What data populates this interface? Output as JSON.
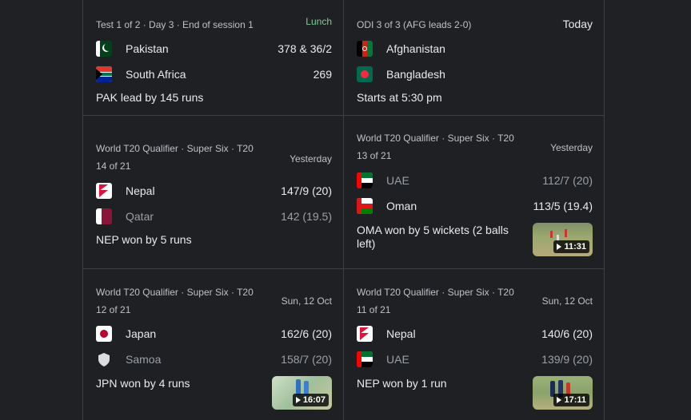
{
  "cards": [
    {
      "meta": "Test 1 of 2 · Day 3 · End of session 1",
      "when": "Lunch",
      "team1": {
        "name": "Pakistan",
        "score": "378 & 36/2",
        "flag": "pakistan-flag-icon"
      },
      "team2": {
        "name": "South Africa",
        "score": "269",
        "flag": "south-africa-flag-icon"
      },
      "result": "PAK lead by 145 runs"
    },
    {
      "meta": "ODI 3 of 3 (AFG leads 2-0)",
      "when": "Today",
      "team1": {
        "name": "Afghanistan",
        "score": "",
        "flag": "afghanistan-flag-icon"
      },
      "team2": {
        "name": "Bangladesh",
        "score": "",
        "flag": "bangladesh-flag-icon"
      },
      "result": "Starts at 5:30 pm"
    },
    {
      "meta1": "World T20 Qualifier · Super Six · T20",
      "meta2": "14 of 21",
      "when": "Yesterday",
      "team1": {
        "name": "Nepal",
        "score": "147/9 (20)",
        "flag": "nepal-flag-icon"
      },
      "team2": {
        "name": "Qatar",
        "score": "142 (19.5)",
        "flag": "qatar-flag-icon"
      },
      "result": "NEP won by 5 runs"
    },
    {
      "meta1": "World T20 Qualifier · Super Six · T20",
      "meta2": "13 of 21",
      "when": "Yesterday",
      "team1": {
        "name": "UAE",
        "score": "112/7 (20)",
        "flag": "uae-flag-icon"
      },
      "team2": {
        "name": "Oman",
        "score": "113/5 (19.4)",
        "flag": "oman-flag-icon"
      },
      "result": "OMA won by 5 wickets (2 balls left)",
      "video": "11:31"
    },
    {
      "meta1": "World T20 Qualifier · Super Six · T20",
      "meta2": "12 of 21",
      "when": "Sun, 12 Oct",
      "team1": {
        "name": "Japan",
        "score": "162/6 (20)",
        "flag": "japan-flag-icon"
      },
      "team2": {
        "name": "Samoa",
        "score": "158/7 (20)",
        "flag": "samoa-shield-icon"
      },
      "result": "JPN won by 4 runs",
      "video": "16:07"
    },
    {
      "meta1": "World T20 Qualifier · Super Six · T20",
      "meta2": "11 of 21",
      "when": "Sun, 12 Oct",
      "team1": {
        "name": "Nepal",
        "score": "140/6 (20)",
        "flag": "nepal-flag-icon"
      },
      "team2": {
        "name": "UAE",
        "score": "139/9 (20)",
        "flag": "uae-flag-icon"
      },
      "result": "NEP won by 1 run",
      "video": "17:11"
    }
  ]
}
